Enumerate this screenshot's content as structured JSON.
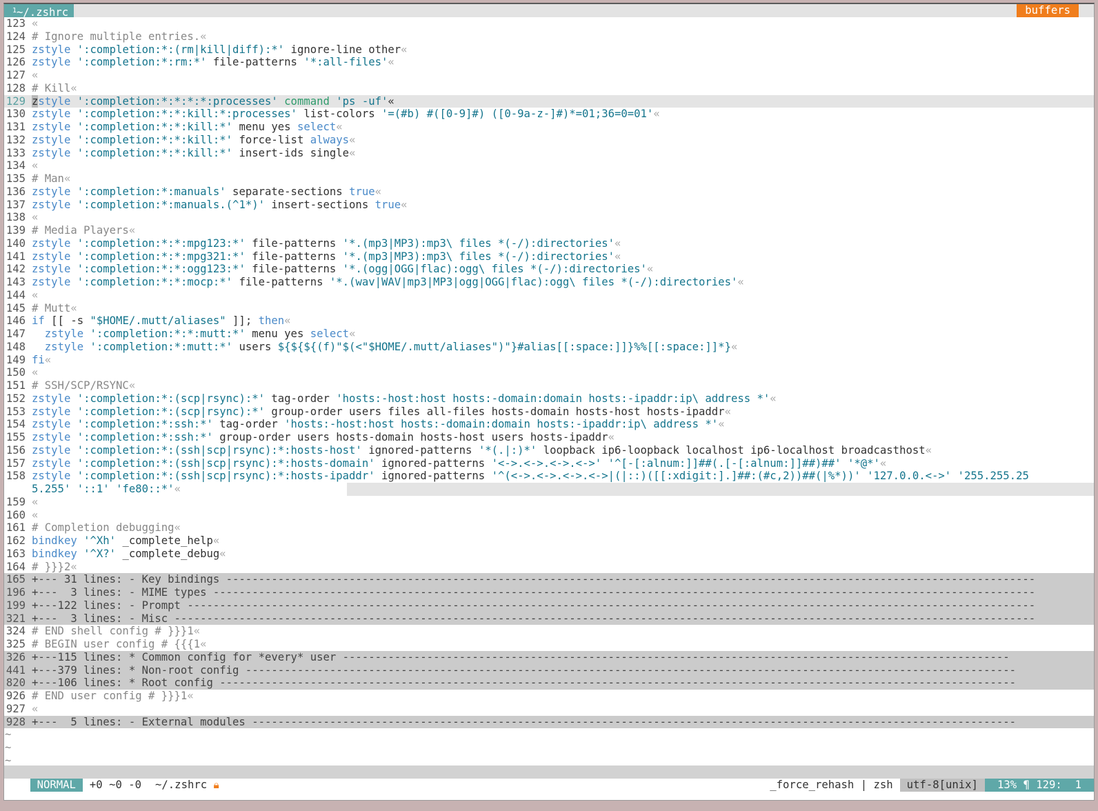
{
  "tabline": {
    "active_tab_number": "1",
    "active_tab_label": "~/.zshrc",
    "buffers_label": "buffers"
  },
  "colors": {
    "accent_teal": "#5fa8a8",
    "accent_orange": "#f07d1c",
    "keyword_blue": "#4a8ac9",
    "string_teal": "#15758d",
    "comment_gray": "#888888"
  },
  "lines": [
    {
      "n": "123",
      "segs": [
        [
          "e",
          "«"
        ]
      ]
    },
    {
      "n": "124",
      "segs": [
        [
          "c",
          "# Ignore multiple entries."
        ],
        [
          "e",
          "«"
        ]
      ]
    },
    {
      "n": "125",
      "segs": [
        [
          "k",
          "zstyle"
        ],
        [
          "t",
          " "
        ],
        [
          "s",
          "':completion:*:(rm|kill|diff):*'"
        ],
        [
          "t",
          " ignore-line other"
        ],
        [
          "e",
          "«"
        ]
      ]
    },
    {
      "n": "126",
      "segs": [
        [
          "k",
          "zstyle"
        ],
        [
          "t",
          " "
        ],
        [
          "s",
          "':completion:*:rm:*'"
        ],
        [
          "t",
          " file-patterns "
        ],
        [
          "s",
          "'*:all-files'"
        ],
        [
          "e",
          "«"
        ]
      ]
    },
    {
      "n": "127",
      "segs": [
        [
          "e",
          "«"
        ]
      ]
    },
    {
      "n": "128",
      "segs": [
        [
          "c",
          "# Kill"
        ],
        [
          "e",
          "«"
        ]
      ]
    },
    {
      "n": "129",
      "cls": "cursorline",
      "segs": [
        [
          "u",
          "z"
        ],
        [
          "k",
          "style"
        ],
        [
          "t",
          " "
        ],
        [
          "s",
          "':completion:*:*:*:*:processes'"
        ],
        [
          "t",
          " "
        ],
        [
          "g",
          "command"
        ],
        [
          "t",
          " "
        ],
        [
          "s",
          "'ps -uf'"
        ],
        [
          "t",
          "«"
        ]
      ]
    },
    {
      "n": "130",
      "segs": [
        [
          "k",
          "zstyle"
        ],
        [
          "t",
          " "
        ],
        [
          "s",
          "':completion:*:*:kill:*:processes'"
        ],
        [
          "t",
          " list-colors "
        ],
        [
          "s",
          "'=(#b) #([0-9]#) ([0-9a-z-]#)*=01;36=0=01'"
        ],
        [
          "e",
          "«"
        ]
      ]
    },
    {
      "n": "131",
      "segs": [
        [
          "k",
          "zstyle"
        ],
        [
          "t",
          " "
        ],
        [
          "s",
          "':completion:*:*:kill:*'"
        ],
        [
          "t",
          " menu yes "
        ],
        [
          "k",
          "select"
        ],
        [
          "e",
          "«"
        ]
      ]
    },
    {
      "n": "132",
      "segs": [
        [
          "k",
          "zstyle"
        ],
        [
          "t",
          " "
        ],
        [
          "s",
          "':completion:*:*:kill:*'"
        ],
        [
          "t",
          " force-list "
        ],
        [
          "k",
          "always"
        ],
        [
          "e",
          "«"
        ]
      ]
    },
    {
      "n": "133",
      "segs": [
        [
          "k",
          "zstyle"
        ],
        [
          "t",
          " "
        ],
        [
          "s",
          "':completion:*:*:kill:*'"
        ],
        [
          "t",
          " insert-ids single"
        ],
        [
          "e",
          "«"
        ]
      ]
    },
    {
      "n": "134",
      "segs": [
        [
          "e",
          "«"
        ]
      ]
    },
    {
      "n": "135",
      "segs": [
        [
          "c",
          "# Man"
        ],
        [
          "e",
          "«"
        ]
      ]
    },
    {
      "n": "136",
      "segs": [
        [
          "k",
          "zstyle"
        ],
        [
          "t",
          " "
        ],
        [
          "s",
          "':completion:*:manuals'"
        ],
        [
          "t",
          " separate-sections "
        ],
        [
          "k",
          "true"
        ],
        [
          "e",
          "«"
        ]
      ]
    },
    {
      "n": "137",
      "segs": [
        [
          "k",
          "zstyle"
        ],
        [
          "t",
          " "
        ],
        [
          "s",
          "':completion:*:manuals.(^1*)'"
        ],
        [
          "t",
          " insert-sections "
        ],
        [
          "k",
          "true"
        ],
        [
          "e",
          "«"
        ]
      ]
    },
    {
      "n": "138",
      "segs": [
        [
          "e",
          "«"
        ]
      ]
    },
    {
      "n": "139",
      "segs": [
        [
          "c",
          "# Media Players"
        ],
        [
          "e",
          "«"
        ]
      ]
    },
    {
      "n": "140",
      "segs": [
        [
          "k",
          "zstyle"
        ],
        [
          "t",
          " "
        ],
        [
          "s",
          "':completion:*:*:mpg123:*'"
        ],
        [
          "t",
          " file-patterns "
        ],
        [
          "s",
          "'*.(mp3|MP3):mp3\\ files *(-/):directories'"
        ],
        [
          "e",
          "«"
        ]
      ]
    },
    {
      "n": "141",
      "segs": [
        [
          "k",
          "zstyle"
        ],
        [
          "t",
          " "
        ],
        [
          "s",
          "':completion:*:*:mpg321:*'"
        ],
        [
          "t",
          " file-patterns "
        ],
        [
          "s",
          "'*.(mp3|MP3):mp3\\ files *(-/):directories'"
        ],
        [
          "e",
          "«"
        ]
      ]
    },
    {
      "n": "142",
      "segs": [
        [
          "k",
          "zstyle"
        ],
        [
          "t",
          " "
        ],
        [
          "s",
          "':completion:*:*:ogg123:*'"
        ],
        [
          "t",
          " file-patterns "
        ],
        [
          "s",
          "'*.(ogg|OGG|flac):ogg\\ files *(-/):directories'"
        ],
        [
          "e",
          "«"
        ]
      ]
    },
    {
      "n": "143",
      "segs": [
        [
          "k",
          "zstyle"
        ],
        [
          "t",
          " "
        ],
        [
          "s",
          "':completion:*:*:mocp:*'"
        ],
        [
          "t",
          " file-patterns "
        ],
        [
          "s",
          "'*.(wav|WAV|mp3|MP3|ogg|OGG|flac):ogg\\ files *(-/):directories'"
        ],
        [
          "e",
          "«"
        ]
      ]
    },
    {
      "n": "144",
      "segs": [
        [
          "e",
          "«"
        ]
      ]
    },
    {
      "n": "145",
      "segs": [
        [
          "c",
          "# Mutt"
        ],
        [
          "e",
          "«"
        ]
      ]
    },
    {
      "n": "146",
      "segs": [
        [
          "k",
          "if"
        ],
        [
          "t",
          " [[ -s "
        ],
        [
          "s",
          "\"$HOME/.mutt/aliases\""
        ],
        [
          "t",
          " ]]; "
        ],
        [
          "k",
          "then"
        ],
        [
          "e",
          "«"
        ]
      ]
    },
    {
      "n": "147",
      "segs": [
        [
          "t",
          "  "
        ],
        [
          "k",
          "zstyle"
        ],
        [
          "t",
          " "
        ],
        [
          "s",
          "':completion:*:*:mutt:*'"
        ],
        [
          "t",
          " menu yes "
        ],
        [
          "k",
          "select"
        ],
        [
          "e",
          "«"
        ]
      ]
    },
    {
      "n": "148",
      "segs": [
        [
          "t",
          "  "
        ],
        [
          "k",
          "zstyle"
        ],
        [
          "t",
          " "
        ],
        [
          "s",
          "':completion:*:mutt:*'"
        ],
        [
          "t",
          " users "
        ],
        [
          "s",
          "${${${(f)\"$(<\"$HOME/.mutt/aliases\")\"}#alias[[:space:]]}%%[[:space:]]*}"
        ],
        [
          "e",
          "«"
        ]
      ]
    },
    {
      "n": "149",
      "segs": [
        [
          "k",
          "fi"
        ],
        [
          "e",
          "«"
        ]
      ]
    },
    {
      "n": "150",
      "segs": [
        [
          "e",
          "«"
        ]
      ]
    },
    {
      "n": "151",
      "segs": [
        [
          "c",
          "# SSH/SCP/RSYNC"
        ],
        [
          "e",
          "«"
        ]
      ]
    },
    {
      "n": "152",
      "segs": [
        [
          "k",
          "zstyle"
        ],
        [
          "t",
          " "
        ],
        [
          "s",
          "':completion:*:(scp|rsync):*'"
        ],
        [
          "t",
          " tag-order "
        ],
        [
          "s",
          "'hosts:-host:host hosts:-domain:domain hosts:-ipaddr:ip\\ address *'"
        ],
        [
          "e",
          "«"
        ]
      ]
    },
    {
      "n": "153",
      "segs": [
        [
          "k",
          "zstyle"
        ],
        [
          "t",
          " "
        ],
        [
          "s",
          "':completion:*:(scp|rsync):*'"
        ],
        [
          "t",
          " group-order users files all-files hosts-domain hosts-host hosts-ipaddr"
        ],
        [
          "e",
          "«"
        ]
      ]
    },
    {
      "n": "154",
      "segs": [
        [
          "k",
          "zstyle"
        ],
        [
          "t",
          " "
        ],
        [
          "s",
          "':completion:*:ssh:*'"
        ],
        [
          "t",
          " tag-order "
        ],
        [
          "s",
          "'hosts:-host:host hosts:-domain:domain hosts:-ipaddr:ip\\ address *'"
        ],
        [
          "e",
          "«"
        ]
      ]
    },
    {
      "n": "155",
      "segs": [
        [
          "k",
          "zstyle"
        ],
        [
          "t",
          " "
        ],
        [
          "s",
          "':completion:*:ssh:*'"
        ],
        [
          "t",
          " group-order users hosts-domain hosts-host users hosts-ipaddr"
        ],
        [
          "e",
          "«"
        ]
      ]
    },
    {
      "n": "156",
      "segs": [
        [
          "k",
          "zstyle"
        ],
        [
          "t",
          " "
        ],
        [
          "s",
          "':completion:*:(ssh|scp|rsync):*:hosts-host'"
        ],
        [
          "t",
          " ignored-patterns "
        ],
        [
          "s",
          "'*(.|:)*'"
        ],
        [
          "t",
          " loopback ip6-loopback localhost ip6-localhost broadcasthost"
        ],
        [
          "e",
          "«"
        ]
      ]
    },
    {
      "n": "157",
      "segs": [
        [
          "k",
          "zstyle"
        ],
        [
          "t",
          " "
        ],
        [
          "s",
          "':completion:*:(ssh|scp|rsync):*:hosts-domain'"
        ],
        [
          "t",
          " ignored-patterns "
        ],
        [
          "s",
          "'<->.<->.<->.<->'"
        ],
        [
          "t",
          " "
        ],
        [
          "s",
          "'^[-[:alnum:]]##(.[-[:alnum:]]##)##'"
        ],
        [
          "t",
          " "
        ],
        [
          "s",
          "'*@*'"
        ],
        [
          "e",
          "«"
        ]
      ]
    },
    {
      "n": "158",
      "segs": [
        [
          "k",
          "zstyle"
        ],
        [
          "t",
          " "
        ],
        [
          "s",
          "':completion:*:(ssh|scp|rsync):*:hosts-ipaddr'"
        ],
        [
          "t",
          " ignored-patterns "
        ],
        [
          "s",
          "'^(<->.<->.<->.<->|(|::)([[:xdigit:].]##:(#c,2))##(|%*))'"
        ],
        [
          "t",
          " "
        ],
        [
          "s",
          "'127.0.0.<->'"
        ],
        [
          "t",
          " "
        ],
        [
          "s",
          "'255.255.25"
        ]
      ]
    },
    {
      "n": "",
      "cls": "wrap-cont",
      "segs": [
        [
          "s",
          "5.255'"
        ],
        [
          "t",
          " "
        ],
        [
          "s",
          "'::1'"
        ],
        [
          "t",
          " "
        ],
        [
          "s",
          "'fe80::*'"
        ],
        [
          "e",
          "«"
        ]
      ]
    },
    {
      "n": "159",
      "segs": [
        [
          "e",
          "«"
        ]
      ]
    },
    {
      "n": "160",
      "segs": [
        [
          "e",
          "«"
        ]
      ]
    },
    {
      "n": "161",
      "segs": [
        [
          "c",
          "# Completion debugging"
        ],
        [
          "e",
          "«"
        ]
      ]
    },
    {
      "n": "162",
      "segs": [
        [
          "k",
          "bindkey"
        ],
        [
          "t",
          " "
        ],
        [
          "s",
          "'^Xh'"
        ],
        [
          "t",
          " _complete_help"
        ],
        [
          "e",
          "«"
        ]
      ]
    },
    {
      "n": "163",
      "segs": [
        [
          "k",
          "bindkey"
        ],
        [
          "t",
          " "
        ],
        [
          "s",
          "'^X?'"
        ],
        [
          "t",
          " _complete_debug"
        ],
        [
          "e",
          "«"
        ]
      ]
    },
    {
      "n": "164",
      "segs": [
        [
          "c",
          "# }}}2"
        ],
        [
          "e",
          "«"
        ]
      ]
    },
    {
      "n": "165",
      "cls": "fold",
      "segs": [
        [
          "t",
          "+--- 31 lines: - Key bindings -----------------------------------------------------------------------------------------------------------------------------"
        ]
      ]
    },
    {
      "n": "196",
      "cls": "fold",
      "segs": [
        [
          "t",
          "+---  3 lines: - MIME types -------------------------------------------------------------------------------------------------------------------------------"
        ]
      ]
    },
    {
      "n": "199",
      "cls": "fold",
      "segs": [
        [
          "t",
          "+---122 lines: - Prompt -----------------------------------------------------------------------------------------------------------------------------------"
        ]
      ]
    },
    {
      "n": "321",
      "cls": "fold",
      "segs": [
        [
          "t",
          "+---  3 lines: - Misc -------------------------------------------------------------------------------------------------------------------------------------"
        ]
      ]
    },
    {
      "n": "324",
      "segs": [
        [
          "c",
          "# END shell config # }}}1"
        ],
        [
          "e",
          "«"
        ]
      ]
    },
    {
      "n": "325",
      "segs": [
        [
          "c",
          "# BEGIN user config # {{{1"
        ],
        [
          "e",
          "«"
        ]
      ]
    },
    {
      "n": "326",
      "cls": "fold",
      "segs": [
        [
          "t",
          "+---115 lines: * Common config for *every* user -------------------------------------------------------------------------------------------------------"
        ]
      ]
    },
    {
      "n": "441",
      "cls": "fold",
      "segs": [
        [
          "t",
          "+---379 lines: * Non-root config -----------------------------------------------------------------------------------------------------------------------"
        ]
      ]
    },
    {
      "n": "820",
      "cls": "fold",
      "segs": [
        [
          "t",
          "+---106 lines: * Root config ---------------------------------------------------------------------------------------------------------------------------"
        ]
      ]
    },
    {
      "n": "926",
      "segs": [
        [
          "c",
          "# END user config # }}}1"
        ],
        [
          "e",
          "«"
        ]
      ]
    },
    {
      "n": "927",
      "segs": [
        [
          "e",
          "«"
        ]
      ]
    },
    {
      "n": "928",
      "cls": "fold",
      "segs": [
        [
          "t",
          "+---  5 lines: - External modules ----------------------------------------------------------------------------------------------------------------------"
        ]
      ]
    }
  ],
  "tildes": [
    "~",
    "~",
    "~"
  ],
  "statusline": {
    "mode": "NORMAL",
    "diff": "+0 ~0 -0",
    "file": "~/.zshrc",
    "lock_icon": "lock-icon",
    "function": "_force_rehash | zsh",
    "encoding": "utf-8[unix]",
    "position": "13% ¶ 129:  1"
  }
}
